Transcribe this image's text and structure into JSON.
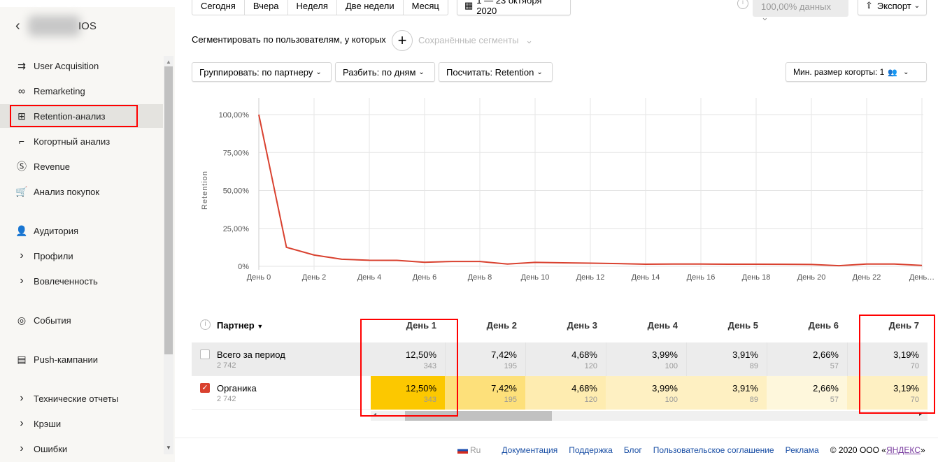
{
  "sidebar": {
    "app_suffix": "IOS",
    "items": [
      {
        "label": "User Acquisition",
        "icon": "arrows-icon"
      },
      {
        "label": "Remarketing",
        "icon": "link-icon"
      },
      {
        "label": "Retention-анализ",
        "icon": "table-icon"
      },
      {
        "label": "Когортный анализ",
        "icon": "curve-icon"
      },
      {
        "label": "Revenue",
        "icon": "dollar-icon"
      },
      {
        "label": "Анализ покупок",
        "icon": "cart-icon"
      },
      {
        "label": "Аудитория",
        "icon": "users-icon"
      },
      {
        "label": "Профили",
        "icon": "chevron-right-icon"
      },
      {
        "label": "Вовлеченность",
        "icon": "chevron-right-icon"
      },
      {
        "label": "События",
        "icon": "target-icon"
      },
      {
        "label": "Push-кампании",
        "icon": "message-icon"
      },
      {
        "label": "Технические отчеты",
        "icon": "chevron-right-icon"
      },
      {
        "label": "Крэши",
        "icon": "chevron-right-icon"
      },
      {
        "label": "Ошибки",
        "icon": "chevron-right-icon"
      }
    ]
  },
  "toolbar": {
    "periods": [
      "Сегодня",
      "Вчера",
      "Неделя",
      "Две недели",
      "Месяц"
    ],
    "date_range": "1 — 23 октября 2020",
    "sampling": "100,00% данных",
    "export": "Экспорт"
  },
  "segment": {
    "label": "Сегментировать по пользователям, у которых",
    "saved": "Сохранённые сегменты"
  },
  "filters": {
    "group": "Группировать: по партнеру",
    "split": "Разбить: по дням",
    "count": "Посчитать: Retention",
    "min_cohort": "Мин. размер когорты: 1"
  },
  "chart_data": {
    "type": "line",
    "ylabel": "Retention",
    "yticks": [
      "0%",
      "25,00%",
      "50,00%",
      "75,00%",
      "100,00%"
    ],
    "ylim": [
      0,
      100
    ],
    "xticks": [
      "День 0",
      "День 2",
      "День 4",
      "День 6",
      "День 8",
      "День 10",
      "День 12",
      "День 14",
      "День 16",
      "День 18",
      "День 20",
      "День 22",
      "День…"
    ],
    "series": [
      {
        "name": "Органика",
        "color": "#d9412f",
        "values": [
          100,
          12.5,
          7.42,
          4.68,
          3.99,
          3.91,
          2.66,
          3.19,
          3.19,
          1.5,
          2.6,
          2.3,
          2.1,
          1.8,
          1.4,
          1.5,
          1.5,
          1.4,
          1.4,
          1.3,
          1.2,
          0.4,
          1.5,
          1.5,
          0.6
        ]
      }
    ]
  },
  "table": {
    "partner_header": "Партнер",
    "columns": [
      "День 1",
      "День 2",
      "День 3",
      "День 4",
      "День 5",
      "День 6",
      "День 7"
    ],
    "rows": [
      {
        "name": "Всего за период",
        "total": "2 742",
        "checked": false,
        "cells": [
          {
            "p": "12,50%",
            "n": "343"
          },
          {
            "p": "7,42%",
            "n": "195"
          },
          {
            "p": "4,68%",
            "n": "120"
          },
          {
            "p": "3,99%",
            "n": "100"
          },
          {
            "p": "3,91%",
            "n": "89"
          },
          {
            "p": "2,66%",
            "n": "57"
          },
          {
            "p": "3,19%",
            "n": "70"
          }
        ]
      },
      {
        "name": "Органика",
        "total": "2 742",
        "checked": true,
        "cells": [
          {
            "p": "12,50%",
            "n": "343",
            "bg": "#fcc800"
          },
          {
            "p": "7,42%",
            "n": "195",
            "bg": "#fde07a"
          },
          {
            "p": "4,68%",
            "n": "120",
            "bg": "#feecb0"
          },
          {
            "p": "3,99%",
            "n": "100",
            "bg": "#fef0c2"
          },
          {
            "p": "3,91%",
            "n": "89",
            "bg": "#fef0c2"
          },
          {
            "p": "2,66%",
            "n": "57",
            "bg": "#fef7dc"
          },
          {
            "p": "3,19%",
            "n": "70",
            "bg": "#fef0c2"
          }
        ]
      }
    ]
  },
  "footer": {
    "lang": "Ru",
    "links": [
      "Документация",
      "Поддержка",
      "Блог",
      "Пользовательское соглашение",
      "Реклама"
    ],
    "copyright": "© 2020  ООО «",
    "brand": "ЯНДЕКС",
    "copyright_end": "»"
  }
}
